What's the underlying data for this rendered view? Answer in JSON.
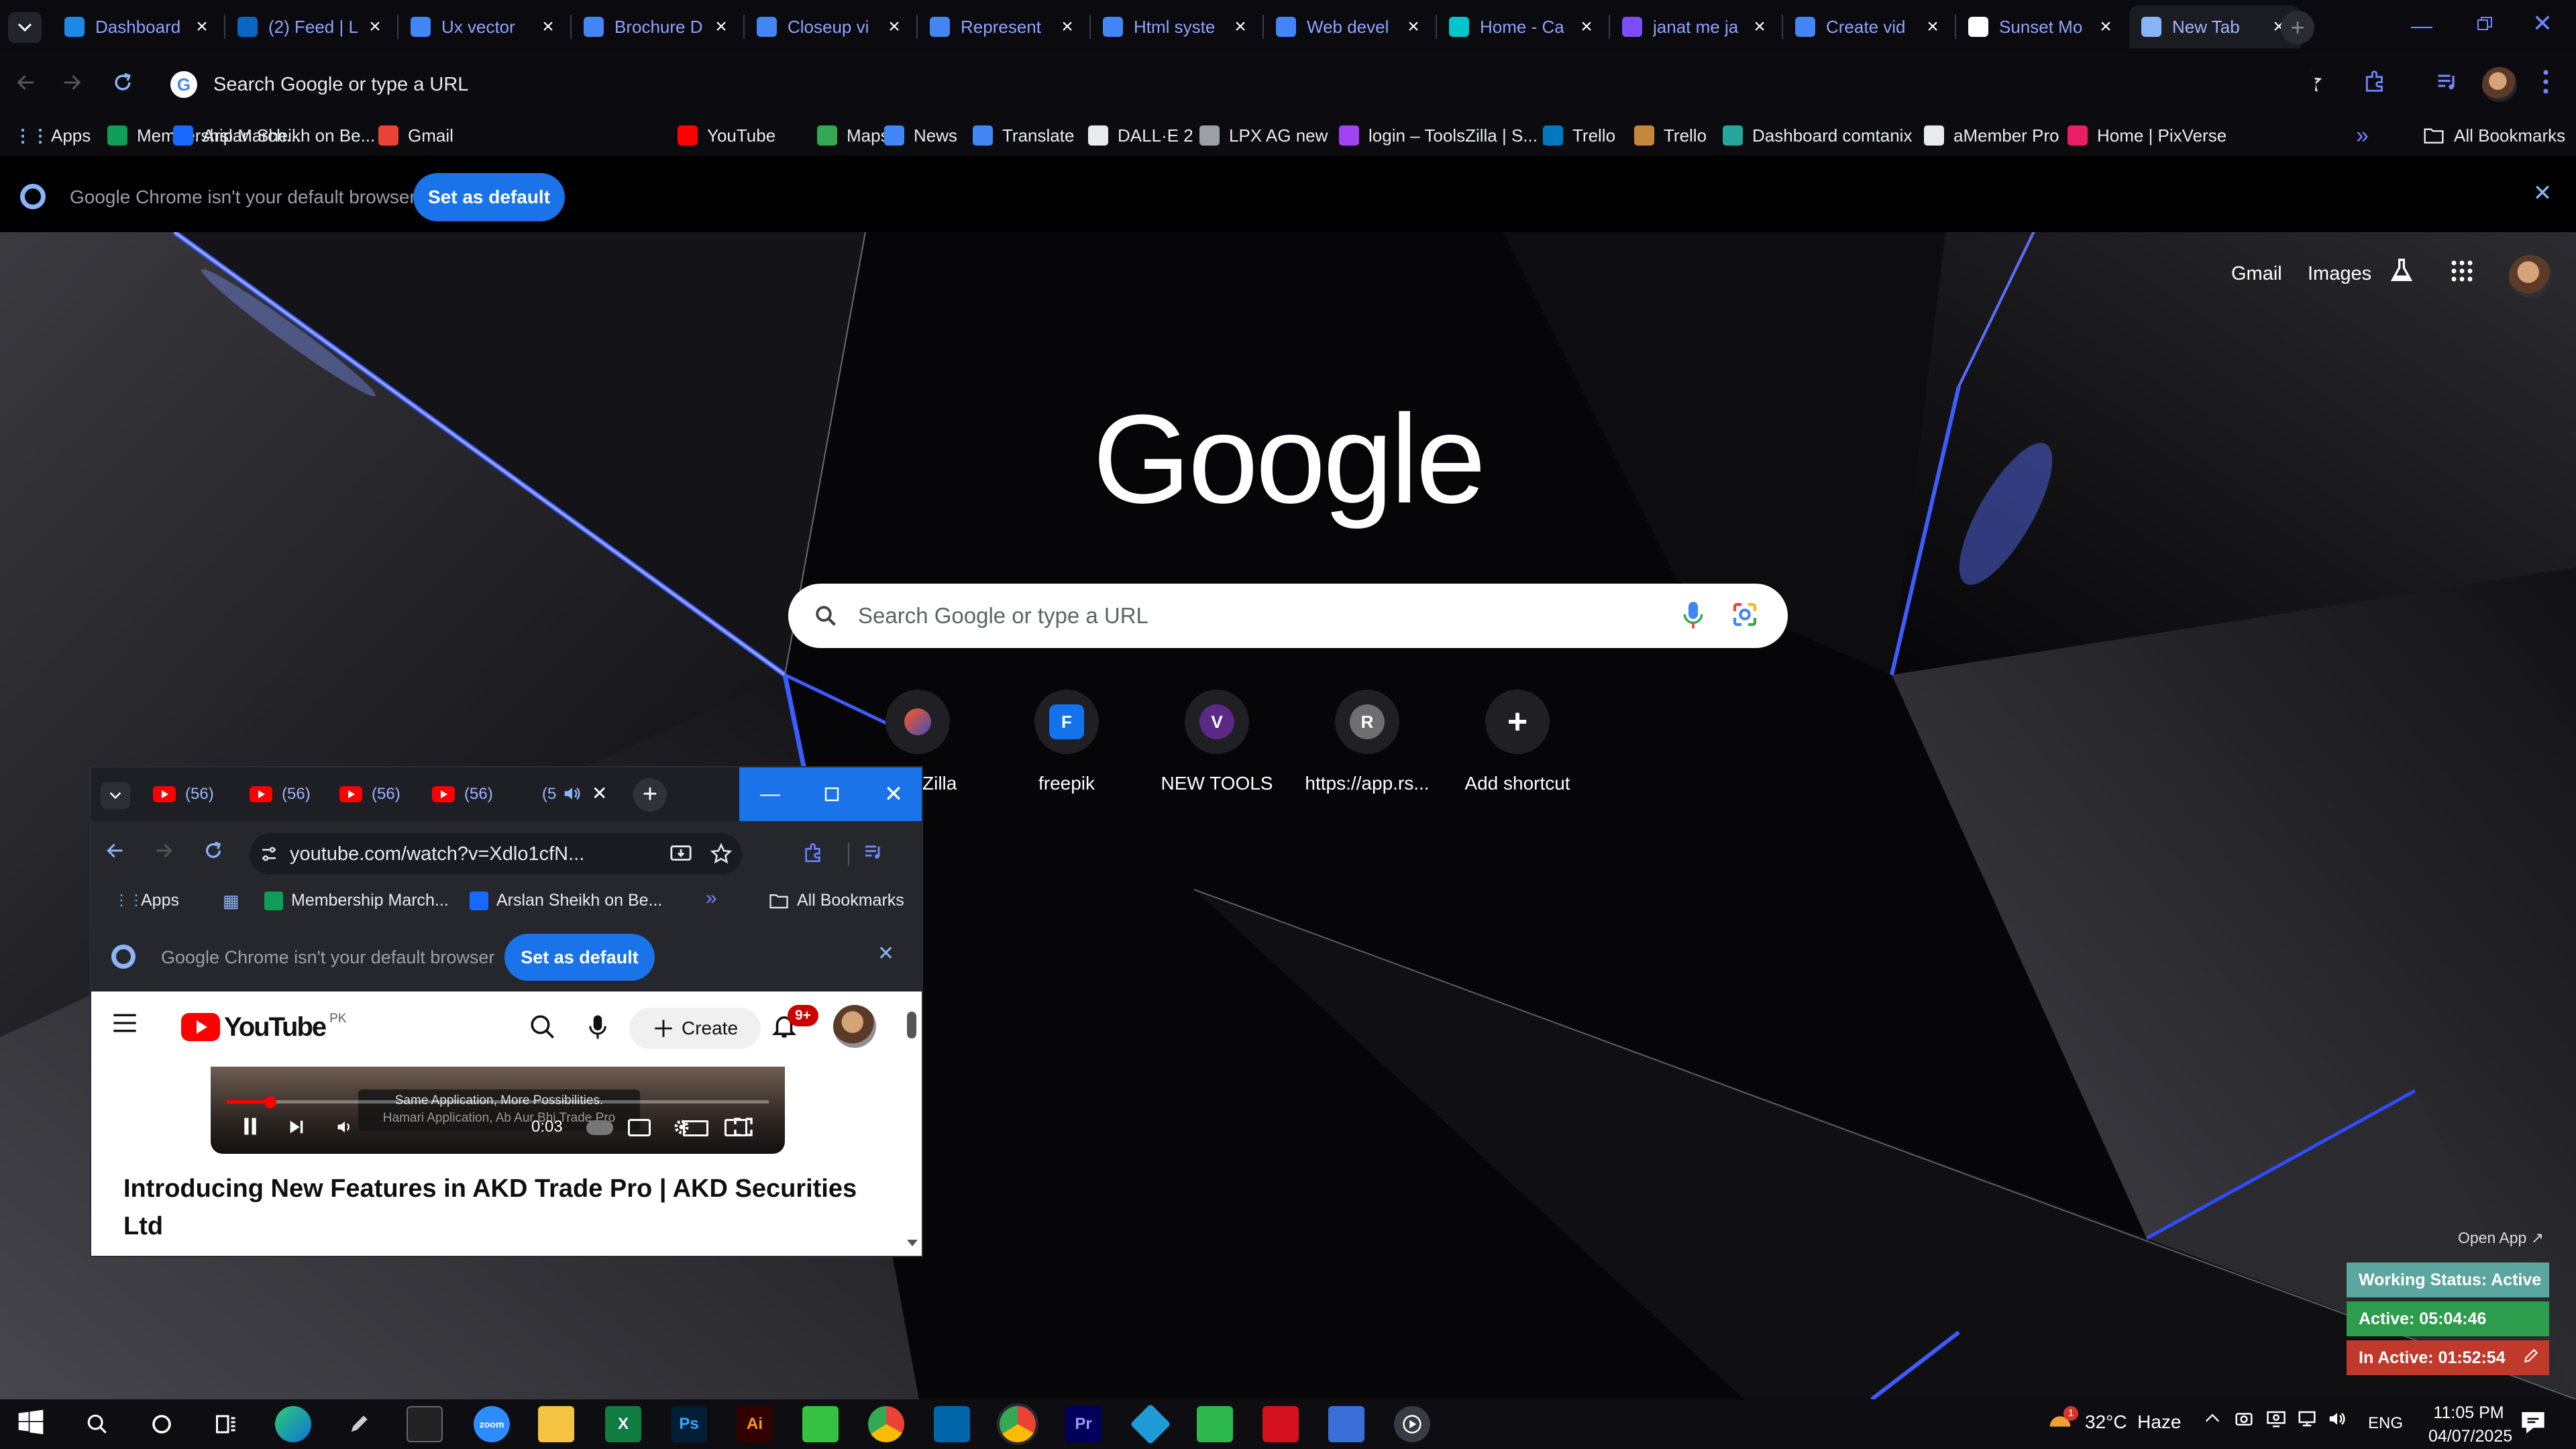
{
  "browser": {
    "tabs": [
      {
        "label": "Dashboard",
        "icon": "dashboard-icon",
        "color": "#1e88e5"
      },
      {
        "label": "(2) Feed | L",
        "icon": "linkedin-icon",
        "color": "#0a66c2"
      },
      {
        "label": "Ux vector",
        "icon": "docs-icon",
        "color": "#4285f4"
      },
      {
        "label": "Brochure D",
        "icon": "docs-icon",
        "color": "#4285f4"
      },
      {
        "label": "Closeup vi",
        "icon": "docs-icon",
        "color": "#4285f4"
      },
      {
        "label": "Represent",
        "icon": "docs-icon",
        "color": "#4285f4"
      },
      {
        "label": "Html syste",
        "icon": "docs-icon",
        "color": "#4285f4"
      },
      {
        "label": "Web devel",
        "icon": "docs-icon",
        "color": "#4285f4"
      },
      {
        "label": "Home - Ca",
        "icon": "canva-icon",
        "color": "#00c4cc"
      },
      {
        "label": "janat me ja",
        "icon": "video-icon",
        "color": "#7c4dff"
      },
      {
        "label": "Create vid",
        "icon": "docs-icon",
        "color": "#4285f4"
      },
      {
        "label": "Sunset Mo",
        "icon": "openai-icon",
        "color": "#ffffff"
      },
      {
        "label": "New Tab",
        "icon": "chrome-icon",
        "color": "#8ab4f8"
      }
    ],
    "omnibox_placeholder": "Search Google or type a URL",
    "bookmarks": [
      {
        "label": "Apps",
        "icon": "apps-icon",
        "color": "#e8eaed"
      },
      {
        "label": "Membership March...",
        "icon": "sheets-icon",
        "color": "#0f9d58"
      },
      {
        "label": "Arslan Sheikh on Be...",
        "icon": "behance-icon",
        "color": "#1769ff"
      },
      {
        "label": "Gmail",
        "icon": "gmail-icon",
        "color": "#ea4335"
      },
      {
        "label": "YouTube",
        "icon": "youtube-icon",
        "color": "#ff0000"
      },
      {
        "label": "Maps",
        "icon": "maps-icon",
        "color": "#34a853"
      },
      {
        "label": "News",
        "icon": "news-icon",
        "color": "#4285f4"
      },
      {
        "label": "Translate",
        "icon": "translate-icon",
        "color": "#4285f4"
      },
      {
        "label": "DALL·E 2",
        "icon": "openai-icon",
        "color": "#e8eaed"
      },
      {
        "label": "LPX AG new",
        "icon": "dots-icon",
        "color": "#9aa0a6"
      },
      {
        "label": "login – ToolsZilla | S...",
        "icon": "toolszilla-icon",
        "color": "#a142f4"
      },
      {
        "label": "Trello",
        "icon": "trello-icon",
        "color": "#0079bf"
      },
      {
        "label": "Trello",
        "icon": "trello-icon",
        "color": "#c5853c"
      },
      {
        "label": "Dashboard comtanix",
        "icon": "comtanix-icon",
        "color": "#26a69a"
      },
      {
        "label": "aMember Pro",
        "icon": "amember-icon",
        "color": "#e8eaed"
      },
      {
        "label": "Home | PixVerse",
        "icon": "pixverse-icon",
        "color": "#e91e63"
      }
    ],
    "all_bookmarks": "All Bookmarks",
    "more_bookmarks": "»",
    "infobar": {
      "text": "Google Chrome isn't your default browser",
      "button": "Set as default"
    }
  },
  "ntp": {
    "links": {
      "gmail": "Gmail",
      "images": "Images"
    },
    "logo": "Google",
    "search_placeholder": "Search Google or type a URL",
    "shortcuts": [
      {
        "label": "ToolsZilla",
        "letter": "",
        "icon": "toolszilla-icon",
        "color": "#1f1f24"
      },
      {
        "label": "freepik",
        "letter": "F",
        "icon": "freepik-icon",
        "color": "#1273eb"
      },
      {
        "label": "NEW TOOLS",
        "letter": "V",
        "icon": "letter-v-icon",
        "color": "#5b2a86"
      },
      {
        "label": "https://app.rs...",
        "letter": "R",
        "icon": "letter-r-icon",
        "color": "#6e6e73"
      },
      {
        "label": "Add shortcut",
        "letter": "+",
        "icon": "plus-icon",
        "color": "#1f1f24"
      }
    ]
  },
  "popup": {
    "tabs": [
      {
        "label": "(56)"
      },
      {
        "label": "(56)"
      },
      {
        "label": "(56)"
      },
      {
        "label": "(56)"
      },
      {
        "label": "(5"
      }
    ],
    "url": "youtube.com/watch?v=Xdlo1cfN...",
    "bookmarks": [
      {
        "label": "Apps"
      },
      {
        "label": "Membership March..."
      },
      {
        "label": "Arslan Sheikh on Be..."
      }
    ],
    "all_bookmarks": "All Bookmarks",
    "infobar": {
      "text": "Google Chrome isn't your default browser",
      "button": "Set as default"
    },
    "youtube": {
      "logo": "YouTube",
      "region": "PK",
      "create": "Create",
      "notifications": "9+",
      "caption_1": "Same Application, More Possibilities.",
      "caption_2": "Hamari Application, Ab Aur Bhi Trade Pro",
      "time": "0:03",
      "progress": 0.08,
      "video_title": "Introducing New Features in AKD Trade Pro | AKD Securities Ltd"
    }
  },
  "status_widget": {
    "open_app": "Open App ↗",
    "working": "Working Status: Active",
    "active": "Active: 05:04:46",
    "inactive": "In Active: 01:52:54",
    "colors": {
      "working": "#5ba69e",
      "active": "#2e9c4d",
      "inactive": "#c0392b"
    }
  },
  "taskbar": {
    "apps": [
      {
        "icon": "search-icon"
      },
      {
        "icon": "cortana-icon"
      },
      {
        "icon": "task-view-icon"
      },
      {
        "icon": "edge-icon"
      },
      {
        "icon": "pen-icon"
      },
      {
        "icon": "terminal-icon"
      },
      {
        "icon": "zoom-icon",
        "text": "zoom"
      },
      {
        "icon": "file-explorer-icon"
      },
      {
        "icon": "excel-icon",
        "text": "X"
      },
      {
        "icon": "photoshop-icon",
        "text": "Ps"
      },
      {
        "icon": "illustrator-icon",
        "text": "Ai"
      },
      {
        "icon": "app-green-icon"
      },
      {
        "icon": "chrome-icon"
      },
      {
        "icon": "vscode-icon"
      },
      {
        "icon": "chrome-canary-icon"
      },
      {
        "icon": "premiere-icon",
        "text": "Pr"
      },
      {
        "icon": "app-diamond-icon"
      },
      {
        "icon": "app-green-2-icon"
      },
      {
        "icon": "acrobat-icon"
      },
      {
        "icon": "calculator-icon"
      },
      {
        "icon": "media-player-icon"
      }
    ],
    "weather": "32°C  Haze",
    "weather_badge": "1",
    "language": "ENG",
    "time": "11:05 PM",
    "date": "04/07/2025"
  }
}
